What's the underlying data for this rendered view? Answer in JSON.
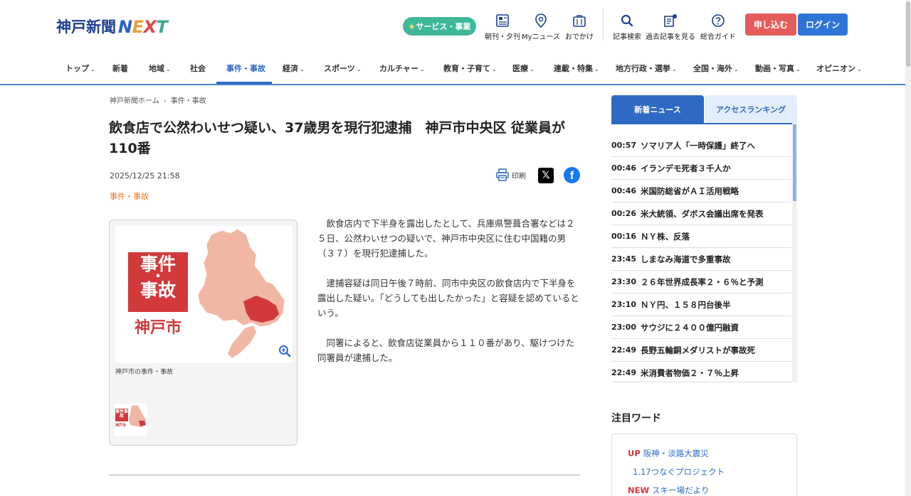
{
  "header": {
    "logo_jp": "神戸新聞",
    "logo_en_letters": [
      "N",
      "E",
      "X",
      "T"
    ],
    "service_label": "サービス・事業",
    "icons": [
      {
        "name": "newspaper-icon",
        "label": "朝刊・夕刊"
      },
      {
        "name": "location-pin-icon",
        "label": "Myニュース"
      },
      {
        "name": "bag-icon",
        "label": "おでかけ"
      },
      {
        "name": "search-icon",
        "label": "記事検索"
      },
      {
        "name": "archive-icon",
        "label": "過去記事を見る"
      },
      {
        "name": "help-icon",
        "label": "総合ガイド"
      }
    ],
    "apply_label": "申し込む",
    "login_label": "ログイン"
  },
  "nav": {
    "items": [
      {
        "label": "トップ",
        "chevron": true
      },
      {
        "label": "新着",
        "chevron": false
      },
      {
        "label": "地域",
        "chevron": true
      },
      {
        "label": "社会",
        "chevron": false
      },
      {
        "label": "事件・事故",
        "chevron": false,
        "active": true
      },
      {
        "label": "経済",
        "chevron": true
      },
      {
        "label": "スポーツ",
        "chevron": true
      },
      {
        "label": "カルチャー",
        "chevron": true
      },
      {
        "label": "教育・子育て",
        "chevron": true
      },
      {
        "label": "医療",
        "chevron": true
      },
      {
        "label": "連載・特集",
        "chevron": true
      },
      {
        "label": "地方行政・選挙",
        "chevron": true
      },
      {
        "label": "全国・海外",
        "chevron": true
      },
      {
        "label": "動画・写真",
        "chevron": true
      },
      {
        "label": "オピニオン",
        "chevron": true
      }
    ]
  },
  "article": {
    "breadcrumb": [
      "神戸新聞ホーム",
      "事件・事故"
    ],
    "breadcrumb_sep": "›",
    "title": "飲食店で公然わいせつ疑い、37歳男を現行犯逮捕　神戸市中央区 従業員が110番",
    "date": "2025/12/25 21:58",
    "category": "事件・事故",
    "print_label": "印刷",
    "image": {
      "stamp_line1": "事件",
      "stamp_dot": "・",
      "stamp_line2": "事故",
      "city": "神戸市",
      "caption": "神戸市の事件・事故",
      "thumb_stamp": "事件事故",
      "thumb_city": "神戸市"
    },
    "paragraphs": [
      "飲食店内で下半身を露出したとして、兵庫県警葺合署などは２５日、公然わいせつの疑いで、神戸市中央区に住む中国籍の男（３７）を現行犯逮捕した。",
      "逮捕容疑は同日午後７時前、同市中央区の飲食店内で下半身を露出した疑い。「どうしても出したかった」と容疑を認めているという。",
      "同署によると、飲食店従業員から１１０番があり、駆けつけた同署員が逮捕した。"
    ]
  },
  "sidebar": {
    "tab_new": "新着ニュース",
    "tab_ranking": "アクセスランキング",
    "news": [
      {
        "time": "00:57",
        "title": "ソマリア人「一時保護」終了へ"
      },
      {
        "time": "00:46",
        "title": "イランデモ死者３千人か"
      },
      {
        "time": "00:46",
        "title": "米国防総省がＡＩ活用戦略"
      },
      {
        "time": "00:26",
        "title": "米大統領、ダボス会議出席を発表"
      },
      {
        "time": "00:16",
        "title": "ＮＹ株、反落"
      },
      {
        "time": "23:45",
        "title": "しまなみ海道で多重事故"
      },
      {
        "time": "23:30",
        "title": "２６年世界成長率２・６％と予測"
      },
      {
        "time": "23:10",
        "title": "ＮＹ円、１５８円台後半"
      },
      {
        "time": "23:00",
        "title": "サウジに２４００億円融資"
      },
      {
        "time": "22:49",
        "title": "長野五輪銅メダリストが事故死"
      },
      {
        "time": "22:49",
        "title": "米消費者物価２・７％上昇"
      }
    ],
    "keywords_heading": "注目ワード",
    "keywords": [
      {
        "tag": "UP",
        "label": "阪神・淡路大震災"
      },
      {
        "tag": "",
        "label": "1.17つなぐプロジェクト"
      },
      {
        "tag": "NEW",
        "label": "スキー場だより"
      }
    ]
  },
  "colors": {
    "brand_blue": "#1c3f8f",
    "accent_blue": "#2e6ac4",
    "service_green": "#3fb89a",
    "apply_red": "#e55c5c",
    "category_orange": "#e27a23",
    "stamp_red": "#d2393b"
  }
}
